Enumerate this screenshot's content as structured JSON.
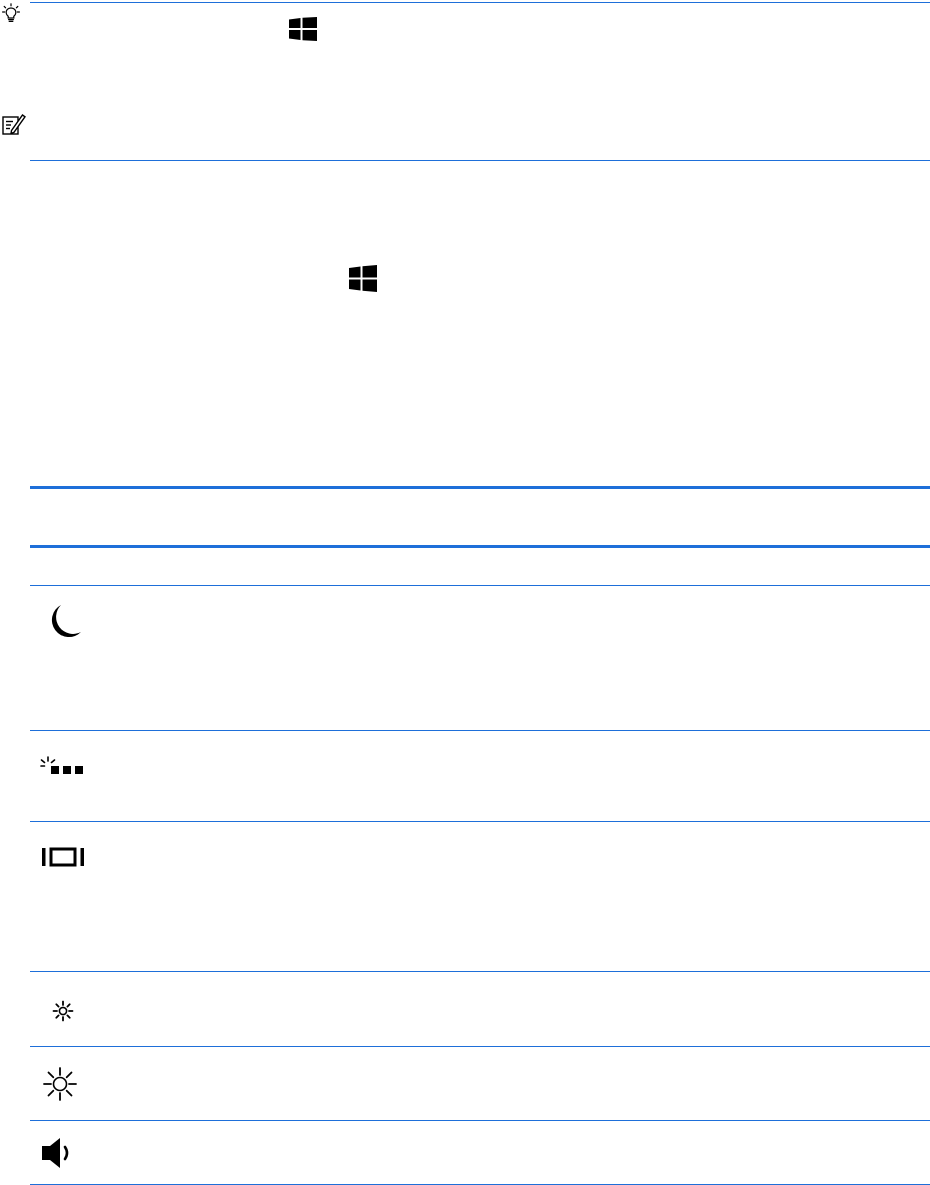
{
  "tip_section": {
    "tip_icon": "lightbulb-icon",
    "windows_key_icon": "windows-logo-icon",
    "note_icon": "note-icon"
  },
  "instruction_section": {
    "windows_key_icon": "windows-logo-icon"
  },
  "action_key_table": {
    "rows": [
      {
        "icon": "sleep-moon-icon"
      },
      {
        "icon": "keyboard-backlight-icon"
      },
      {
        "icon": "switch-display-icon"
      },
      {
        "icon": "brightness-down-icon"
      },
      {
        "icon": "brightness-up-icon"
      },
      {
        "icon": "volume-speaker-icon"
      }
    ]
  },
  "colors": {
    "rule": "#1e6fd9",
    "icon": "#000000"
  }
}
